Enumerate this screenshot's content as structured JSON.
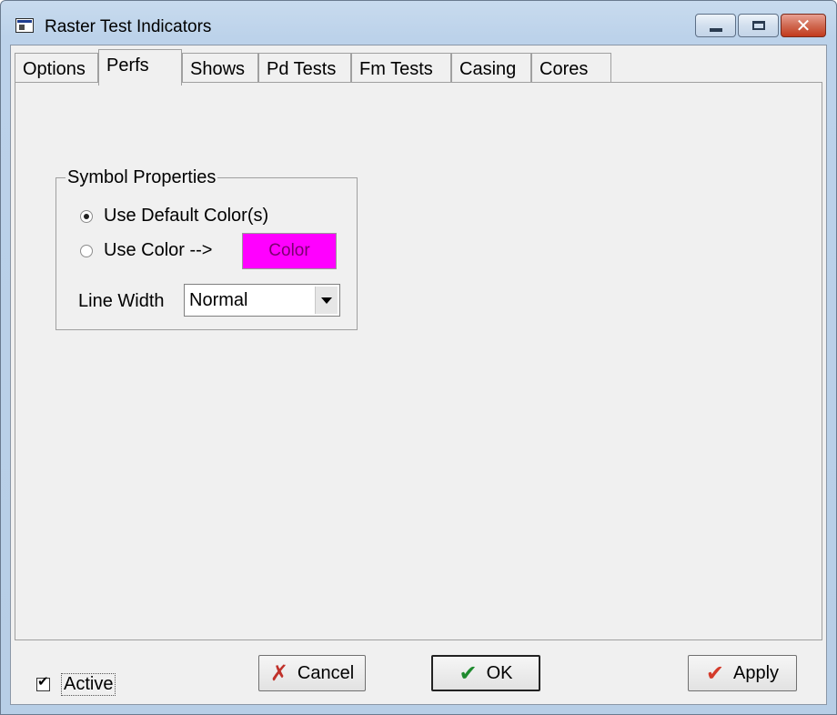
{
  "window": {
    "title": "Raster Test Indicators"
  },
  "tabs": [
    {
      "label": "Options"
    },
    {
      "label": "Perfs"
    },
    {
      "label": "Shows"
    },
    {
      "label": "Pd Tests"
    },
    {
      "label": "Fm Tests"
    },
    {
      "label": "Casing"
    },
    {
      "label": "Cores"
    }
  ],
  "active_tab": "Perfs",
  "symbol_properties": {
    "title": "Symbol Properties",
    "radio_default_label": "Use Default Color(s)",
    "radio_color_label": "Use Color -->",
    "selected_option": "Use Default Color(s)",
    "color_button_label": "Color",
    "color_hex": "#ff00ff",
    "line_width_label": "Line Width",
    "line_width_value": "Normal"
  },
  "footer": {
    "active_label": "Active",
    "active_checked": true,
    "cancel_label": "Cancel",
    "ok_label": "OK",
    "apply_label": "Apply"
  },
  "icons": {
    "app": "window-icon",
    "cancel": "x-icon",
    "ok": "check-icon",
    "apply": "check-icon"
  }
}
